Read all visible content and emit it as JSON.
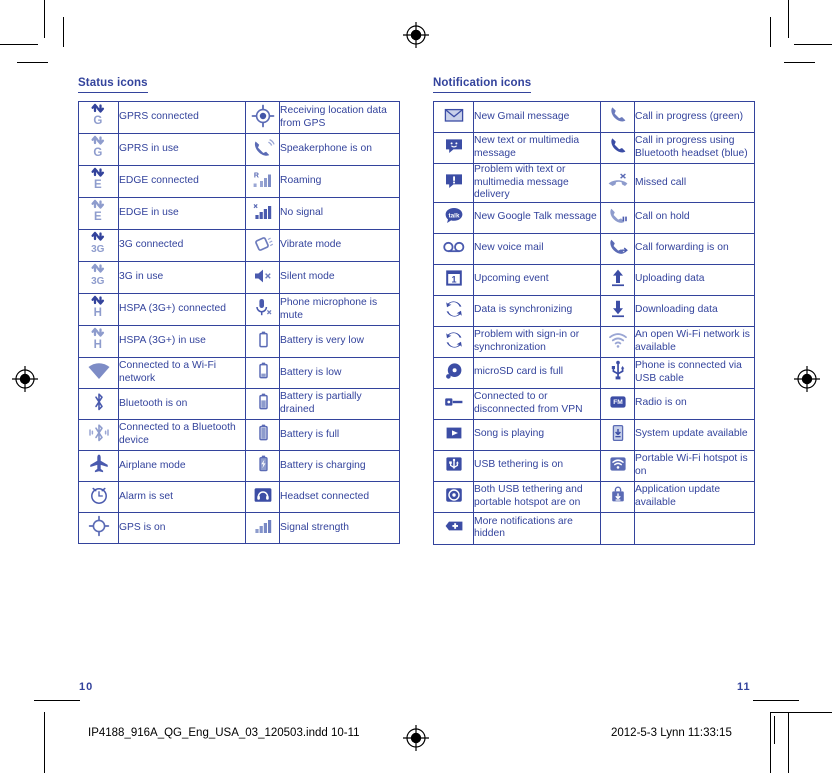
{
  "document": {
    "page_numbers": {
      "left": "10",
      "right": "11"
    },
    "imprint_left": "IP4188_916A_QG_Eng_USA_03_120503.indd   10-11",
    "imprint_right": "2012-5-3   Lynn 11:33:15"
  },
  "colors": {
    "ink": "#33439c",
    "icon_light": "#8e9ccd",
    "icon_mid": "#6d7cbd",
    "rule": "#000000",
    "page_bg": "#ffffff"
  },
  "status_section": {
    "title": "Status icons",
    "rows": [
      {
        "left_icon": "gprs-connected-icon",
        "left_text": "GPRS connected",
        "right_icon": "gps-location-icon",
        "right_text": "Receiving location data from GPS"
      },
      {
        "left_icon": "gprs-in-use-icon",
        "left_text": "GPRS in use",
        "right_icon": "speakerphone-icon",
        "right_text": "Speakerphone is on"
      },
      {
        "left_icon": "edge-connected-icon",
        "left_text": "EDGE connected",
        "right_icon": "roaming-icon",
        "right_text": "Roaming"
      },
      {
        "left_icon": "edge-in-use-icon",
        "left_text": "EDGE in use",
        "right_icon": "no-signal-icon",
        "right_text": "No signal"
      },
      {
        "left_icon": "3g-connected-icon",
        "left_text": "3G connected",
        "right_icon": "vibrate-mode-icon",
        "right_text": "Vibrate mode"
      },
      {
        "left_icon": "3g-in-use-icon",
        "left_text": "3G in use",
        "right_icon": "silent-mode-icon",
        "right_text": "Silent mode"
      },
      {
        "left_icon": "hspa-connected-icon",
        "left_text": "HSPA (3G+) connected",
        "right_icon": "microphone-mute-icon",
        "right_text": "Phone microphone is mute"
      },
      {
        "left_icon": "hspa-in-use-icon",
        "left_text": "HSPA (3G+) in use",
        "right_icon": "battery-very-low-icon",
        "right_text": "Battery is very low"
      },
      {
        "left_icon": "wifi-connected-icon",
        "left_text": "Connected to a Wi-Fi network",
        "right_icon": "battery-low-icon",
        "right_text": "Battery is low"
      },
      {
        "left_icon": "bluetooth-on-icon",
        "left_text": "Bluetooth is on",
        "right_icon": "battery-partial-icon",
        "right_text": "Battery is partially drained"
      },
      {
        "left_icon": "bluetooth-connected-icon",
        "left_text": "Connected to a Bluetooth device",
        "right_icon": "battery-full-icon",
        "right_text": "Battery is full"
      },
      {
        "left_icon": "airplane-mode-icon",
        "left_text": "Airplane mode",
        "right_icon": "battery-charging-icon",
        "right_text": "Battery is charging"
      },
      {
        "left_icon": "alarm-icon",
        "left_text": "Alarm is set",
        "right_icon": "headset-icon",
        "right_text": "Headset connected"
      },
      {
        "left_icon": "gps-on-icon",
        "left_text": "GPS is on",
        "right_icon": "signal-strength-icon",
        "right_text": "Signal strength"
      }
    ]
  },
  "notification_section": {
    "title": "Notification icons",
    "rows": [
      {
        "left_icon": "gmail-icon",
        "left_text": "New Gmail message",
        "right_icon": "call-in-progress-icon",
        "right_text": "Call in progress (green)"
      },
      {
        "left_icon": "sms-message-icon",
        "left_text": "New text or multimedia message",
        "right_icon": "call-bluetooth-icon",
        "right_text": "Call in progress using Bluetooth headset (blue)"
      },
      {
        "left_icon": "message-problem-icon",
        "left_text": "Problem with text or multimedia message delivery",
        "right_icon": "missed-call-icon",
        "right_text": "Missed call"
      },
      {
        "left_icon": "google-talk-icon",
        "left_text": "New Google Talk message",
        "right_icon": "call-on-hold-icon",
        "right_text": "Call on hold"
      },
      {
        "left_icon": "voicemail-icon",
        "left_text": "New voice mail",
        "right_icon": "call-forwarding-icon",
        "right_text": "Call forwarding is on"
      },
      {
        "left_icon": "calendar-event-icon",
        "left_text": "Upcoming event",
        "right_icon": "upload-icon",
        "right_text": "Uploading data"
      },
      {
        "left_icon": "sync-icon",
        "left_text": "Data is synchronizing",
        "right_icon": "download-icon",
        "right_text": "Downloading data"
      },
      {
        "left_icon": "sync-problem-icon",
        "left_text": "Problem with sign-in or synchronization",
        "right_icon": "open-wifi-icon",
        "right_text": "An open Wi-Fi network is available"
      },
      {
        "left_icon": "sd-card-full-icon",
        "left_text": "microSD card is full",
        "right_icon": "usb-cable-icon",
        "right_text": "Phone is connected via USB cable"
      },
      {
        "left_icon": "vpn-icon",
        "left_text": "Connected to or disconnected from VPN",
        "right_icon": "fm-radio-icon",
        "right_text": "Radio is on"
      },
      {
        "left_icon": "music-play-icon",
        "left_text": "Song is playing",
        "right_icon": "system-update-icon",
        "right_text": "System update available"
      },
      {
        "left_icon": "usb-tethering-icon",
        "left_text": "USB tethering is on",
        "right_icon": "portable-hotspot-icon",
        "right_text": "Portable Wi-Fi hotspot is on"
      },
      {
        "left_icon": "tethering-hotspot-icon",
        "left_text": "Both USB tethering and portable hotspot are on",
        "right_icon": "app-update-icon",
        "right_text": "Application update available"
      },
      {
        "left_icon": "more-notifications-icon",
        "left_text": "More notifications are hidden",
        "right_icon": "",
        "right_text": ""
      }
    ]
  }
}
